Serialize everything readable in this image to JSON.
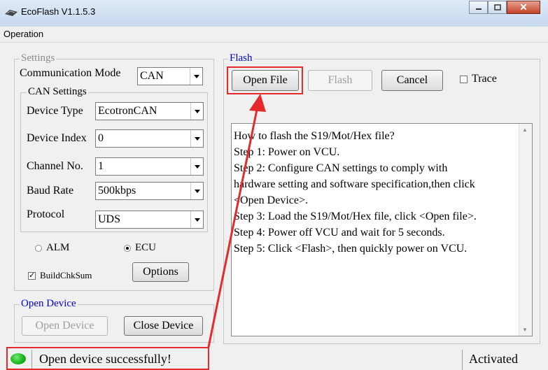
{
  "window": {
    "title": "EcoFlash V1.1.5.3",
    "close_glyph": "✕"
  },
  "menu": {
    "operation": "Operation"
  },
  "settings": {
    "legend": "Settings",
    "comm_mode_label": "Communication Mode",
    "comm_mode_value": "CAN",
    "can_settings": {
      "legend": "CAN Settings",
      "device_type_label": "Device Type",
      "device_type_value": "EcotronCAN",
      "device_index_label": "Device Index",
      "device_index_value": "0",
      "channel_label": "Channel No.",
      "channel_value": "1",
      "baud_label": "Baud Rate",
      "baud_value": "500kbps",
      "protocol_label": "Protocol",
      "protocol_value": "UDS"
    },
    "radio_alm": "ALM",
    "radio_ecu": "ECU",
    "selected_mode": "ECU",
    "buildchksum_label": "BuildChkSum",
    "buildchksum_checked": true,
    "options_button": "Options"
  },
  "open_device": {
    "legend": "Open Device",
    "open_button": "Open Device",
    "close_button": "Close Device"
  },
  "flash": {
    "legend": "Flash",
    "open_file_button": "Open File",
    "flash_button": "Flash",
    "cancel_button": "Cancel",
    "trace_label": "Trace",
    "trace_checked": false,
    "instructions": [
      "How to flash the S19/Mot/Hex file?",
      "Step 1: Power on VCU.",
      "Step 2: Configure CAN settings to comply with",
      "hardware setting and software specification,then click",
      "<Open Device>.",
      "Step 3: Load the S19/Mot/Hex file, click <Open file>.",
      "Step 4: Power off VCU and wait for 5 seconds.",
      "Step 5: Click <Flash>, then quickly power on VCU."
    ]
  },
  "status": {
    "message": "Open device successfully!",
    "state": "Activated"
  },
  "colors": {
    "highlight": "#e42a2a",
    "status_led": "#16b21a",
    "legend_blue": "#0000cc"
  }
}
